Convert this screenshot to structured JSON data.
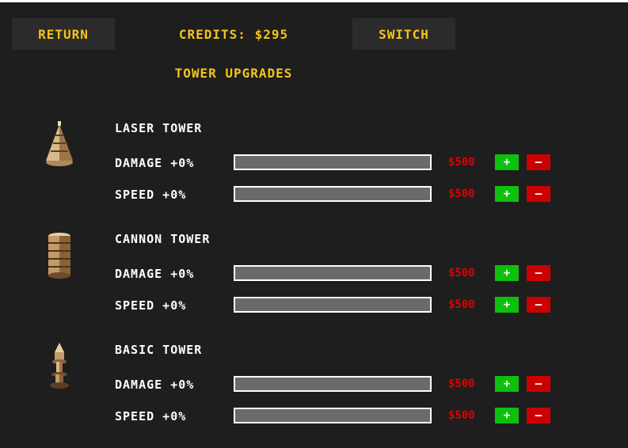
{
  "top_bar": {
    "return_label": "RETURN",
    "credits_text": "CREDITS: $295",
    "switch_label": "SWITCH"
  },
  "title": "TOWER UPGRADES",
  "towers": [
    {
      "name": "LASER TOWER",
      "icon": "laser-tower-icon",
      "upgrades": [
        {
          "label": "DAMAGE +0%",
          "price": "$500",
          "plus": "+",
          "minus": "–",
          "progress": 0
        },
        {
          "label": "SPEED +0%",
          "price": "$500",
          "plus": "+",
          "minus": "–",
          "progress": 0
        }
      ]
    },
    {
      "name": "CANNON TOWER",
      "icon": "cannon-tower-icon",
      "upgrades": [
        {
          "label": "DAMAGE +0%",
          "price": "$500",
          "plus": "+",
          "minus": "–",
          "progress": 0
        },
        {
          "label": "SPEED +0%",
          "price": "$500",
          "plus": "+",
          "minus": "–",
          "progress": 0
        }
      ]
    },
    {
      "name": "BASIC TOWER",
      "icon": "basic-tower-icon",
      "upgrades": [
        {
          "label": "DAMAGE +0%",
          "price": "$500",
          "plus": "+",
          "minus": "–",
          "progress": 0
        },
        {
          "label": "SPEED +0%",
          "price": "$500",
          "plus": "+",
          "minus": "–",
          "progress": 0
        }
      ]
    }
  ],
  "colors": {
    "background": "#1e1e1e",
    "accent": "#f6c31a",
    "price": "#e00000",
    "plus_button": "#0ec00e",
    "minus_button": "#cc0000",
    "bar_track": "#6a6a6a"
  }
}
